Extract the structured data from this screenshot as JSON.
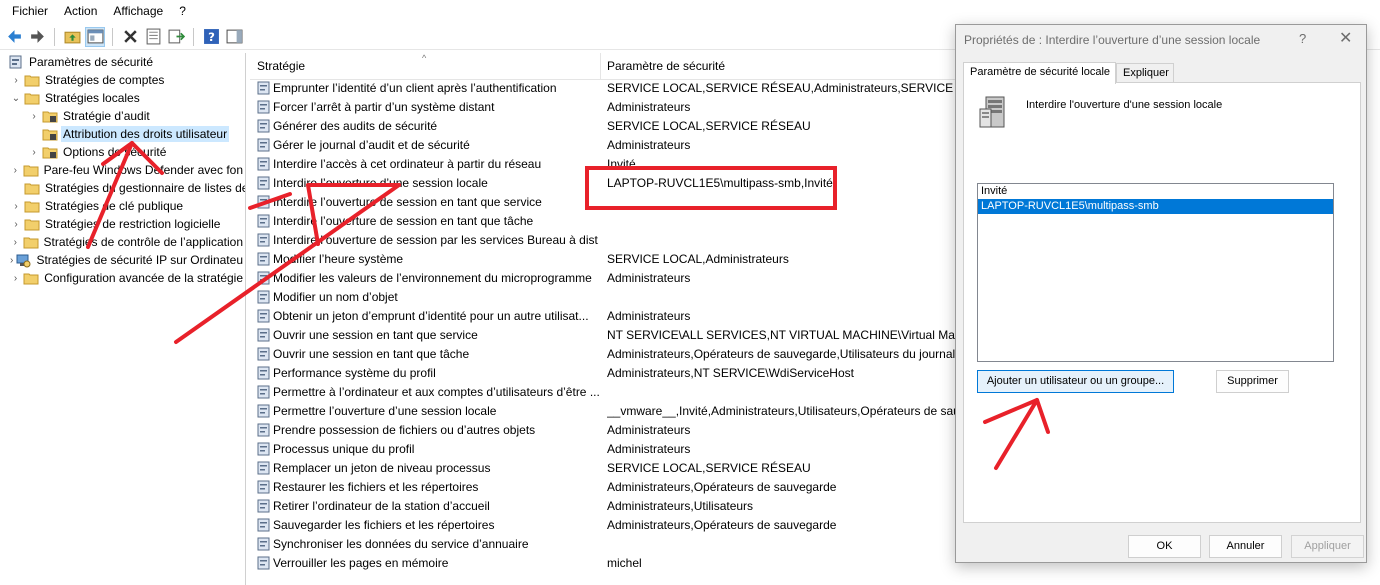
{
  "menu": {
    "items": [
      "Fichier",
      "Action",
      "Affichage",
      "?"
    ]
  },
  "toolbar": {
    "buttons": [
      "back-icon",
      "forward-icon",
      "up-folder-icon",
      "show-hide-tree-icon",
      "delete-icon",
      "properties-icon",
      "export-icon",
      "help-icon",
      "action-pane-icon"
    ]
  },
  "tree": {
    "items": [
      {
        "label": "Paramètres de sécurité"
      },
      {
        "label": "Stratégies de comptes"
      },
      {
        "label": "Stratégies locales"
      },
      {
        "label": "Stratégie d’audit"
      },
      {
        "label": "Attribution des droits utilisateur"
      },
      {
        "label": "Options de sécurité"
      },
      {
        "label": "Pare-feu Windows Defender avec fon"
      },
      {
        "label": "Stratégies du gestionnaire de listes de"
      },
      {
        "label": "Stratégies de clé publique"
      },
      {
        "label": "Stratégies de restriction logicielle"
      },
      {
        "label": "Stratégies de contrôle de l’application"
      },
      {
        "label": "Stratégies de sécurité IP sur Ordinateu"
      },
      {
        "label": "Configuration avancée de la stratégie"
      }
    ]
  },
  "list": {
    "col_policy": "Stratégie",
    "col_setting": "Paramètre de sécurité",
    "rows": [
      {
        "policy": "Emprunter l’identité d’un client après l’authentification",
        "value": "SERVICE LOCAL,SERVICE RÉSEAU,Administrateurs,SERVICE"
      },
      {
        "policy": "Forcer l’arrêt à partir d’un système distant",
        "value": "Administrateurs"
      },
      {
        "policy": "Générer des audits de sécurité",
        "value": "SERVICE LOCAL,SERVICE RÉSEAU"
      },
      {
        "policy": "Gérer le journal d’audit et de sécurité",
        "value": "Administrateurs"
      },
      {
        "policy": "Interdire l’accès à cet ordinateur à partir du réseau",
        "value": "Invité"
      },
      {
        "policy": "Interdire l’ouverture d’une session locale",
        "value": "LAPTOP-RUVCL1E5\\multipass-smb,Invité"
      },
      {
        "policy": "Interdire l’ouverture de session en tant que service",
        "value": ""
      },
      {
        "policy": "Interdire l’ouverture de session en tant que tâche",
        "value": ""
      },
      {
        "policy": "Interdire l’ouverture de session par les services Bureau à dist...",
        "value": ""
      },
      {
        "policy": "Modifier l’heure système",
        "value": "SERVICE LOCAL,Administrateurs"
      },
      {
        "policy": "Modifier les valeurs de l’environnement du microprogramme",
        "value": "Administrateurs"
      },
      {
        "policy": "Modifier un nom d’objet",
        "value": ""
      },
      {
        "policy": "Obtenir un jeton d’emprunt d’identité pour un autre utilisat...",
        "value": "Administrateurs"
      },
      {
        "policy": "Ouvrir une session en tant que service",
        "value": "NT SERVICE\\ALL SERVICES,NT VIRTUAL MACHINE\\Virtual Machine"
      },
      {
        "policy": "Ouvrir une session en tant que tâche",
        "value": "Administrateurs,Opérateurs de sauvegarde,Utilisateurs du journal d"
      },
      {
        "policy": "Performance système du profil",
        "value": "Administrateurs,NT SERVICE\\WdiServiceHost"
      },
      {
        "policy": "Permettre à l’ordinateur et aux comptes d’utilisateurs d’être ...",
        "value": ""
      },
      {
        "policy": "Permettre l’ouverture d’une session locale",
        "value": "__vmware__,Invité,Administrateurs,Utilisateurs,Opérateurs de sauve"
      },
      {
        "policy": "Prendre possession de fichiers ou d’autres objets",
        "value": "Administrateurs"
      },
      {
        "policy": "Processus unique du profil",
        "value": "Administrateurs"
      },
      {
        "policy": "Remplacer un jeton de niveau processus",
        "value": "SERVICE LOCAL,SERVICE RÉSEAU"
      },
      {
        "policy": "Restaurer les fichiers et les répertoires",
        "value": "Administrateurs,Opérateurs de sauvegarde"
      },
      {
        "policy": "Retirer l’ordinateur de la station d’accueil",
        "value": "Administrateurs,Utilisateurs"
      },
      {
        "policy": "Sauvegarder les fichiers et les répertoires",
        "value": "Administrateurs,Opérateurs de sauvegarde"
      },
      {
        "policy": "Synchroniser les données du service d’annuaire",
        "value": ""
      },
      {
        "policy": "Verrouiller les pages en mémoire",
        "value": "michel"
      }
    ]
  },
  "dialog": {
    "title": "Propriétés de : Interdire l’ouverture d’une session locale",
    "help": "?",
    "close": "✕",
    "tab_local": "Paramètre de sécurité locale",
    "tab_explain": "Expliquer",
    "policy_name": "Interdire l'ouverture d'une session locale",
    "members": [
      "Invité",
      "LAPTOP-RUVCL1E5\\multipass-smb"
    ],
    "add_button": "Ajouter un utilisateur ou un groupe...",
    "remove_button": "Supprimer",
    "ok_button": "OK",
    "cancel_button": "Annuler",
    "apply_button": "Appliquer"
  },
  "colors": {
    "selection": "#cce8ff",
    "listbox_selection": "#0078d7",
    "annotation": "#e8212a"
  }
}
